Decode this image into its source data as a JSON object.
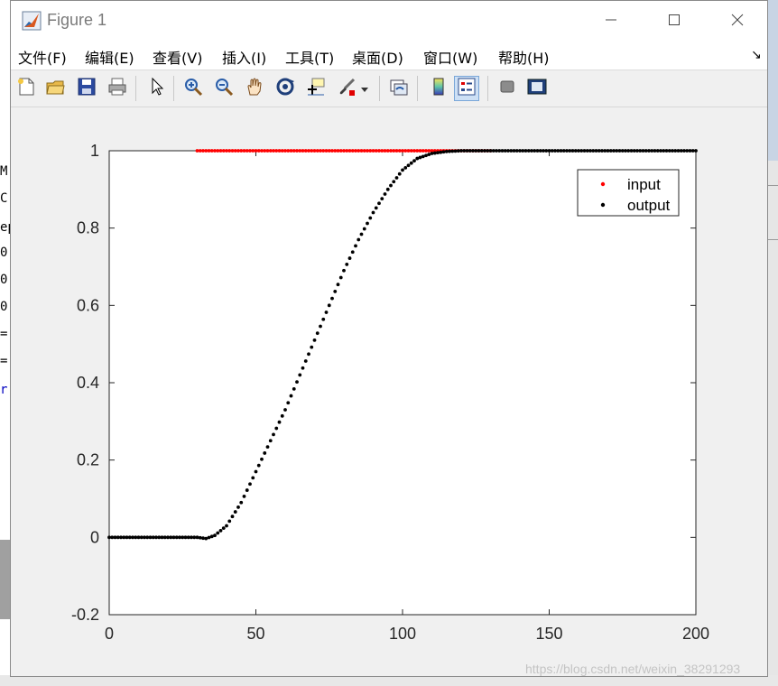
{
  "window": {
    "title": "Figure 1",
    "icon": "matlab-figure-icon",
    "controls": [
      "minimize-icon",
      "maximize-icon",
      "close-icon"
    ]
  },
  "menu": {
    "items": [
      "文件(F)",
      "编辑(E)",
      "查看(V)",
      "插入(I)",
      "工具(T)",
      "桌面(D)",
      "窗口(W)",
      "帮助(H)"
    ],
    "dock_glyph": "↘"
  },
  "toolbar": {
    "tools": [
      "new-figure-icon",
      "open-file-icon",
      "save-icon",
      "print-icon",
      "pointer-icon",
      "zoom-in-icon",
      "zoom-out-icon",
      "pan-hand-icon",
      "rotate-3d-icon",
      "data-cursor-icon",
      "brush-icon",
      "brush-dropdown-icon",
      "link-plot-icon",
      "colorbar-icon",
      "legend-icon",
      "hide-plot-tools-icon",
      "show-plot-tools-icon"
    ],
    "pressed": "legend-icon"
  },
  "background_fragments": [
    "M",
    "C",
    "ep",
    "0",
    "0",
    "0",
    "=",
    "=",
    "r"
  ],
  "watermark": "https://blog.csdn.net/weixin_38291293",
  "colors": {
    "input": "#ff0000",
    "output": "#000000"
  },
  "chart_data": {
    "type": "scatter",
    "xlim": [
      0,
      200
    ],
    "ylim": [
      -0.2,
      1
    ],
    "xticks": [
      0,
      50,
      100,
      150,
      200
    ],
    "xtick_labels": [
      "0",
      "50",
      "100",
      "150",
      "200"
    ],
    "yticks": [
      -0.2,
      0,
      0.2,
      0.4,
      0.6,
      0.8,
      1
    ],
    "ytick_labels": [
      "-0.2",
      "0",
      "0.2",
      "0.4",
      "0.6",
      "0.8",
      "1"
    ],
    "grid": false,
    "legend_position": "top-right",
    "series": [
      {
        "name": "input",
        "color": "#ff0000",
        "x": [
          30,
          35,
          40,
          45,
          50,
          55,
          60,
          65,
          70,
          75,
          80,
          85,
          90,
          95,
          100,
          105,
          110,
          115,
          120,
          125,
          130
        ],
        "y": [
          1,
          1,
          1,
          1,
          1,
          1,
          1,
          1,
          1,
          1,
          1,
          1,
          1,
          1,
          1,
          1,
          1,
          1,
          1,
          1,
          1
        ]
      },
      {
        "name": "output",
        "color": "#000000",
        "x": [
          0,
          5,
          10,
          15,
          20,
          25,
          30,
          33,
          36,
          40,
          45,
          50,
          55,
          60,
          65,
          70,
          75,
          80,
          85,
          90,
          95,
          100,
          105,
          110,
          115,
          120,
          125,
          130,
          140,
          150,
          160,
          170,
          180,
          190,
          200
        ],
        "y": [
          0,
          0,
          0,
          0,
          0,
          0,
          0,
          -0.003,
          0.005,
          0.03,
          0.09,
          0.17,
          0.25,
          0.33,
          0.42,
          0.51,
          0.6,
          0.69,
          0.77,
          0.84,
          0.9,
          0.95,
          0.98,
          0.993,
          0.998,
          1,
          1,
          1,
          1,
          1,
          1,
          1,
          1,
          1,
          1
        ]
      }
    ]
  }
}
